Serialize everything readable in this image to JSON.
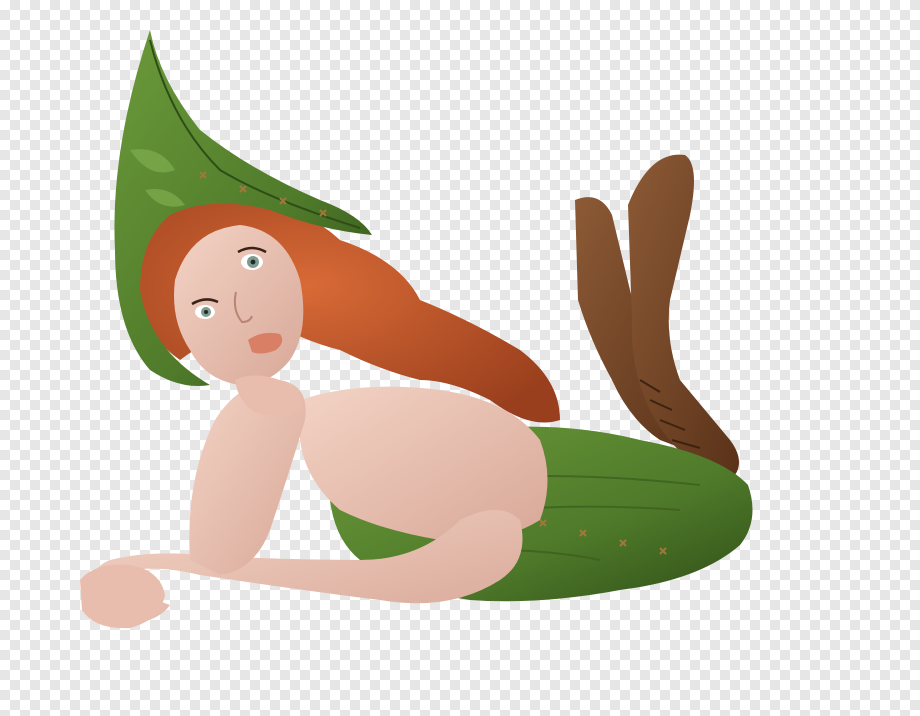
{
  "palette": {
    "checker_light": "#ffffff",
    "checker_dark": "#e6e6e6",
    "leaf_green": "#4f7a2a",
    "leaf_dark": "#2f4d17",
    "hair": "#c4592b",
    "hair_dark": "#9a3f1d",
    "skin": "#ecc3b3",
    "skin_shadow": "#c9968a",
    "boot": "#7a4a2c",
    "boot_dark": "#5a3219",
    "lips": "#d97f66",
    "eye": "#7f9a8f"
  }
}
